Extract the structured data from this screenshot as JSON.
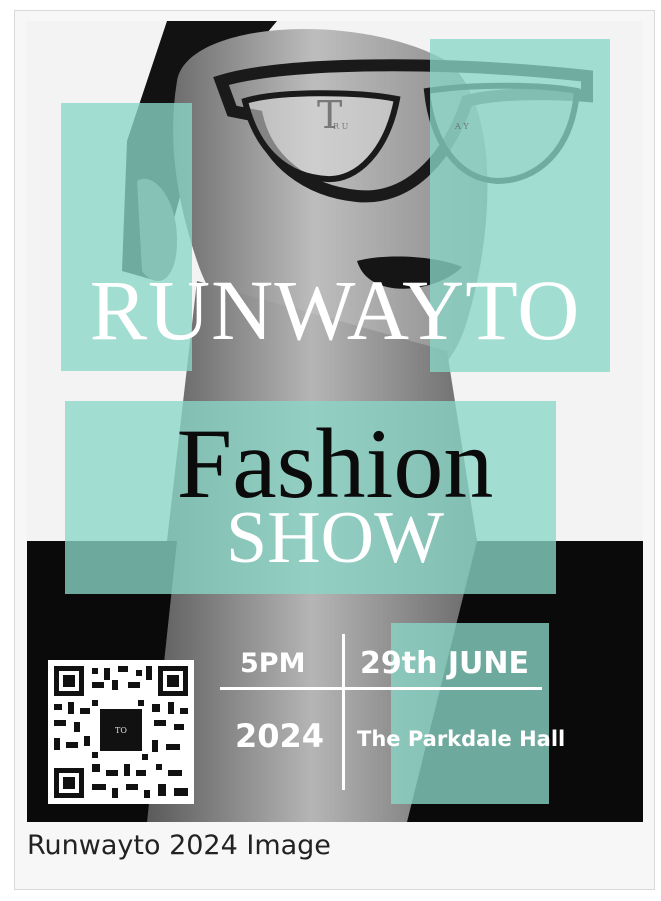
{
  "poster": {
    "brand": "RUNWAYTO",
    "lens_monogram_left": "T",
    "lens_monogram_small_left": "R U",
    "lens_monogram_right": "A Y",
    "title_main": "Fashion",
    "title_sub": "SHOW",
    "time": "5PM",
    "date": "29th JUNE",
    "year": "2024",
    "venue": "The Parkdale Hall",
    "qr_center_text": "TO"
  },
  "caption": "Runwayto 2024 Image",
  "colors": {
    "teal": "#8ad6c8",
    "dark": "#0b0b0b"
  }
}
